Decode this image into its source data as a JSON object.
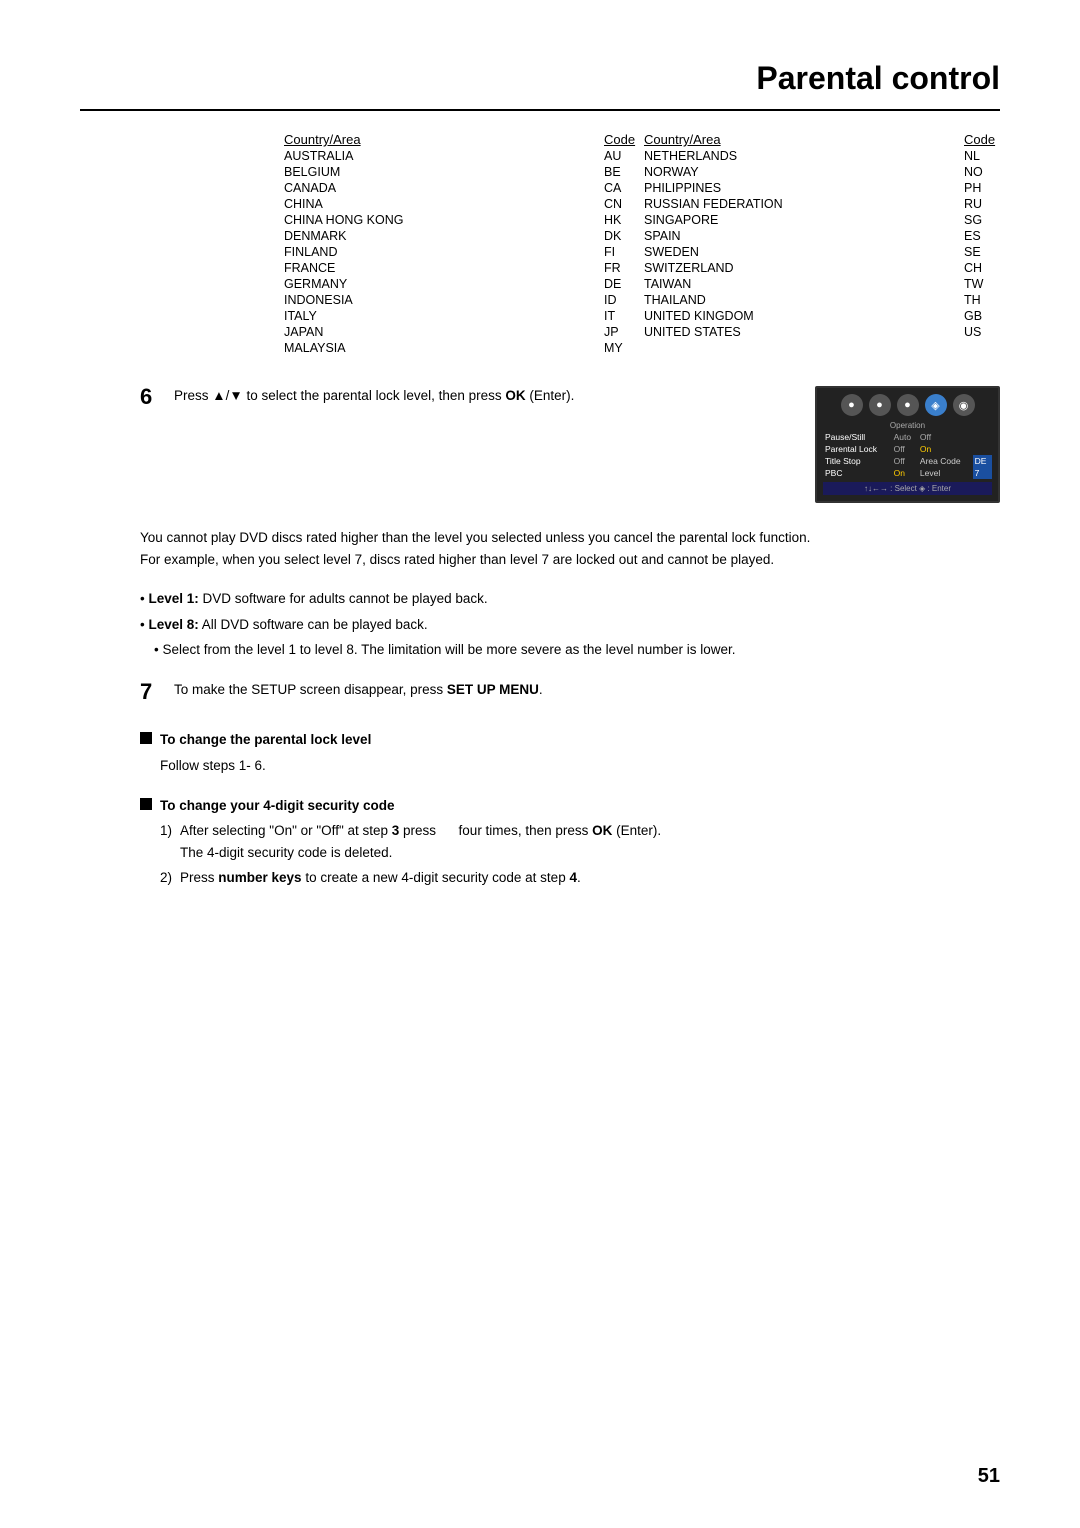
{
  "page": {
    "title": "Parental control",
    "page_number": "51"
  },
  "country_table": {
    "col1": {
      "header_country": "Country/Area",
      "header_code": "Code",
      "rows": [
        {
          "country": "Australia",
          "code": "AU"
        },
        {
          "country": "Belgium",
          "code": "BE"
        },
        {
          "country": "Canada",
          "code": "CA"
        },
        {
          "country": "China",
          "code": "CN"
        },
        {
          "country": "China Hong Kong",
          "code": "HK"
        },
        {
          "country": "Denmark",
          "code": "DK"
        },
        {
          "country": "Finland",
          "code": "FI"
        },
        {
          "country": "France",
          "code": "FR"
        },
        {
          "country": "Germany",
          "code": "DE"
        },
        {
          "country": "Indonesia",
          "code": "ID"
        },
        {
          "country": "Italy",
          "code": "IT"
        },
        {
          "country": "Japan",
          "code": "JP"
        },
        {
          "country": "Malaysia",
          "code": "MY"
        }
      ]
    },
    "col2": {
      "header_country": "Country/Area",
      "header_code": "Code",
      "rows": [
        {
          "country": "Netherlands",
          "code": "NL"
        },
        {
          "country": "Norway",
          "code": "NO"
        },
        {
          "country": "Philippines",
          "code": "PH"
        },
        {
          "country": "Russian Federation",
          "code": "RU"
        },
        {
          "country": "Singapore",
          "code": "SG"
        },
        {
          "country": "Spain",
          "code": "ES"
        },
        {
          "country": "Sweden",
          "code": "SE"
        },
        {
          "country": "Switzerland",
          "code": "CH"
        },
        {
          "country": "Taiwan",
          "code": "TW"
        },
        {
          "country": "Thailand",
          "code": "TH"
        },
        {
          "country": "United Kingdom",
          "code": "GB"
        },
        {
          "country": "United States",
          "code": "US"
        }
      ]
    }
  },
  "step6": {
    "number": "6",
    "text": "Press ▲/▼ to select the parental lock level, then press OK (Enter).",
    "screen": {
      "icons": [
        "●",
        "●",
        "●",
        "◈",
        "◉"
      ],
      "header": "Operation",
      "rows": [
        {
          "label": "Pause/Still",
          "val1": "Auto",
          "val2": "Off"
        },
        {
          "label": "Parental Lock",
          "val1": "Off",
          "val2": "On"
        },
        {
          "label": "Title Stop",
          "val1": "Off",
          "val2": "Area Code",
          "val3": "DE"
        },
        {
          "label": "PBC",
          "val1": "On",
          "val2": "Level",
          "val3": "7"
        }
      ],
      "bottom_bar": "↑↓←→ : Select ◈ : Enter"
    }
  },
  "paragraph1": "You cannot play DVD discs rated higher than the level you selected unless you cancel the parental lock function.",
  "paragraph2": "For example, when you select level 7, discs rated higher than level 7 are locked out and cannot be played.",
  "bullets": [
    {
      "bold_part": "Level 1:",
      "text": " DVD software for adults cannot be played back."
    },
    {
      "bold_part": "Level 8:",
      "text": " All DVD software can be played back."
    },
    {
      "bold_part": "",
      "text": "Select from the level 1 to level 8. The limitation will be more severe as the level number is lower."
    }
  ],
  "step7": {
    "number": "7",
    "text": "To make the SETUP screen disappear, press ",
    "bold_text": "SET UP MENU",
    "text_after": "."
  },
  "sub_section1": {
    "title_bold": "To change the parental lock level",
    "body": "Follow steps 1- 6."
  },
  "sub_section2": {
    "title_bold": "To change your 4-digit security code",
    "items": [
      {
        "num": "1)",
        "text_before": "After selecting \"On\" or \"Off\" at step ",
        "bold_step": "3",
        "text_middle": " press      four times, then press ",
        "bold_ok": "OK",
        "text_after": " (Enter).\nThe 4-digit security code is deleted."
      },
      {
        "num": "2)",
        "text_before": "Press ",
        "bold_keys": "number keys",
        "text_after": " to create a new 4-digit security code at step ",
        "bold_step": "4",
        "period": "."
      }
    ]
  }
}
